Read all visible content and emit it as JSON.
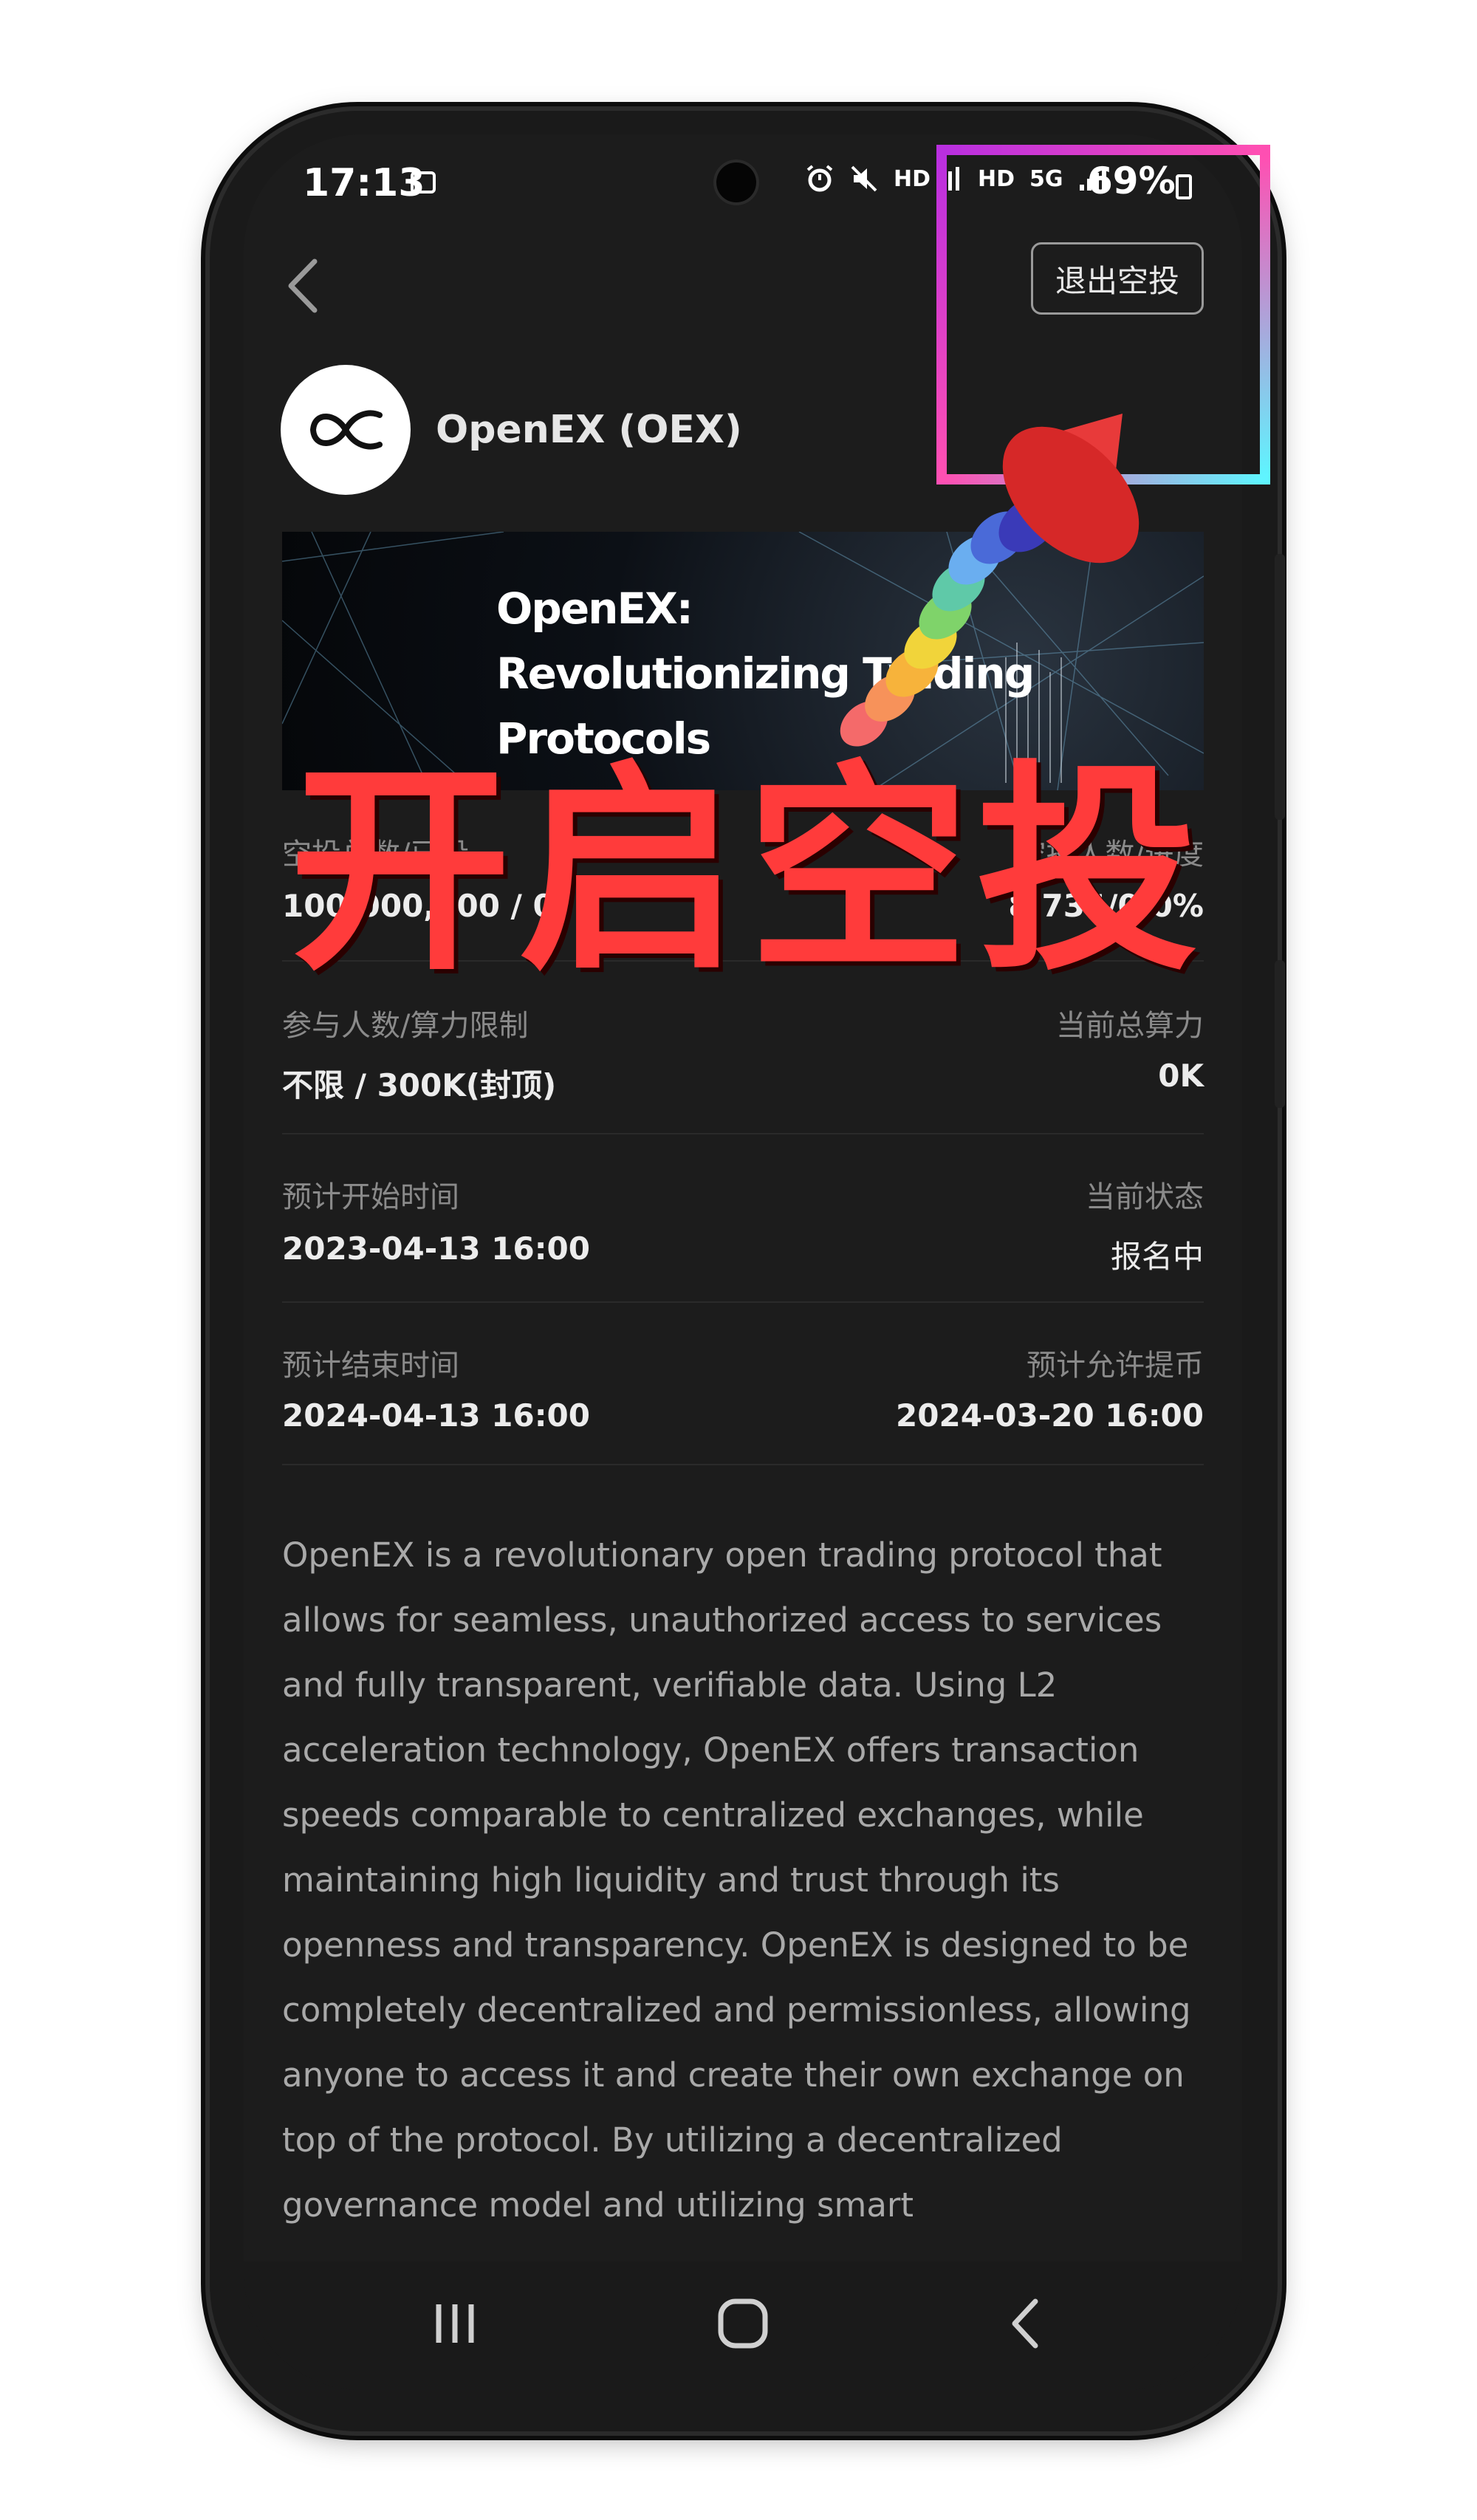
{
  "status_bar": {
    "time": "17:13",
    "hd1": "HD",
    "hd2": "HD",
    "net": "5G",
    "battery": "69%"
  },
  "header": {
    "exit_button": "退出空投"
  },
  "token": {
    "name": "OpenEX (OEX)"
  },
  "banner": {
    "line1": "OpenEX:",
    "line2": "Revolutionizing Trading",
    "line3": "Protocols"
  },
  "stats": {
    "row1": {
      "left_label": "空投总数/已投",
      "left_value": "100,000,000 / 0",
      "right_label": "空投人数/进度",
      "right_value": "8,734/0.0%"
    },
    "row2": {
      "left_label": "参与人数/算力限制",
      "left_value": "不限 / 300K(封顶)",
      "right_label": "当前总算力",
      "right_value": "0K"
    },
    "row3": {
      "left_label": "预计开始时间",
      "left_value": "2023-04-13 16:00",
      "right_label": "当前状态",
      "right_value": "报名中"
    },
    "row4": {
      "left_label": "预计结束时间",
      "left_value": "2024-04-13 16:00",
      "right_label": "预计允许提币",
      "right_value": "2024-03-20 16:00"
    }
  },
  "description": "OpenEX is a revolutionary open trading protocol that allows for seamless, unauthorized access to services and fully transparent, verifiable data. Using L2 acceleration technology, OpenEX offers transaction speeds comparable to centralized exchanges, while maintaining high liquidity and trust through its openness and transparency. OpenEX is designed to be completely decentralized and permissionless, allowing anyone to access it and create their own exchange on top of the protocol. By utilizing a decentralized governance model and utilizing smart",
  "overlay": {
    "title": "开启空投"
  },
  "colors": {
    "background": "#1c1c1c",
    "overlay_red": "#ff3b3b",
    "highlight_gradient": [
      "#b92fe0",
      "#ff4fb2",
      "#5ff4ff"
    ]
  },
  "icons": [
    "back-arrow-icon",
    "image-icon",
    "alarm-icon",
    "mute-icon",
    "signal-icon",
    "battery-icon",
    "recent-apps-icon",
    "home-icon",
    "back-icon"
  ]
}
